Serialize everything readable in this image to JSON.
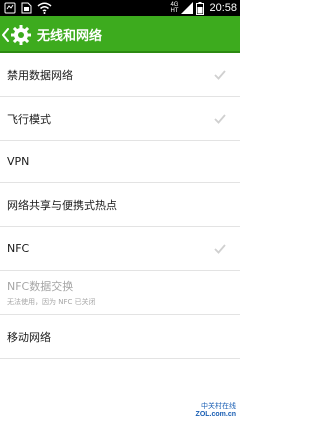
{
  "status_bar": {
    "time": "20:58",
    "network_type": "4G",
    "network_sub": "HT",
    "icons": [
      "android-debug-icon",
      "sim-card-icon",
      "wifi-icon",
      "mobile-signal-icon",
      "battery-icon"
    ]
  },
  "title_bar": {
    "title": "无线和网络",
    "back_icon": "back-chevron-icon",
    "settings_icon": "gear-icon",
    "color": "#3dab1e"
  },
  "settings": [
    {
      "label": "禁用数据网络",
      "has_checkbox": true,
      "checked": false
    },
    {
      "label": "飞行模式",
      "has_checkbox": true,
      "checked": false
    },
    {
      "label": "VPN",
      "has_checkbox": false
    },
    {
      "label": "网络共享与便携式热点",
      "has_checkbox": false
    },
    {
      "label": "NFC",
      "has_checkbox": true,
      "checked": false
    },
    {
      "label": "NFC数据交换",
      "sublabel": "无法使用，因为 NFC 已关闭",
      "disabled": true
    },
    {
      "label": "移动网络",
      "has_checkbox": false
    }
  ],
  "watermark": {
    "line1": "中关村在线",
    "line2": "ZOL.com.cn"
  }
}
